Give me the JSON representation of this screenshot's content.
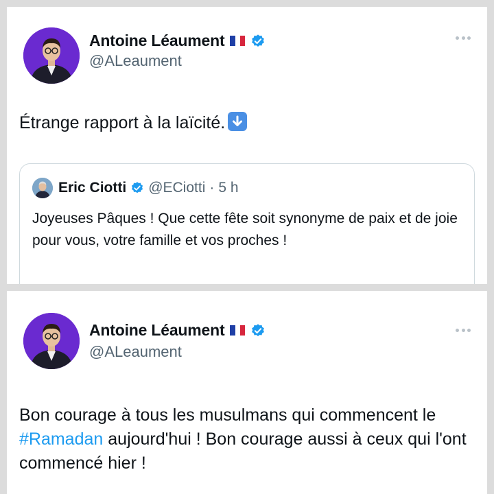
{
  "colors": {
    "accent": "#1d9bf0",
    "avatar_bg": "#6a2ad0",
    "muted": "#536471"
  },
  "tweets": [
    {
      "author": {
        "name": "Antoine Léaument",
        "handle": "@ALeaument",
        "flag": "french-flag",
        "verified": true
      },
      "text": "Étrange rapport à la laïcité.",
      "emoji": "down-arrow-emoji",
      "quote": {
        "author": {
          "name": "Eric Ciotti",
          "handle": "@ECiotti",
          "separator": "·",
          "time": "5 h",
          "verified": true
        },
        "text": "Joyeuses Pâques ! Que cette fête soit synonyme de paix et de joie pour vous, votre famille et vos proches !"
      }
    },
    {
      "author": {
        "name": "Antoine Léaument",
        "handle": "@ALeaument",
        "flag": "french-flag",
        "verified": true
      },
      "text_before": "Bon courage à tous les musulmans qui commencent le ",
      "hashtag": "#Ramadan",
      "text_after": " aujourd'hui ! Bon courage aussi à ceux qui l'ont commencé hier !"
    }
  ]
}
